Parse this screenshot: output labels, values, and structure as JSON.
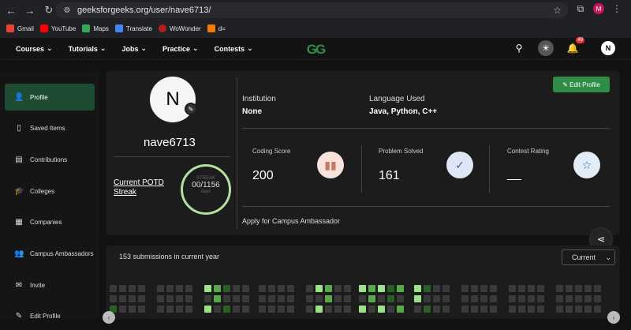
{
  "browser": {
    "url": "geeksforgeeks.org/user/nave6713/",
    "bookmarks": [
      "Gmail",
      "YouTube",
      "Maps",
      "Translate",
      "WoWonder",
      "d="
    ],
    "profile_initial": "M"
  },
  "nav": {
    "items": [
      "Courses",
      "Tutorials",
      "Jobs",
      "Practice",
      "Contests"
    ],
    "logo": "GG",
    "notifications": "49",
    "user_initial": "N"
  },
  "sidebar": {
    "items": [
      {
        "label": "Profile",
        "icon": "user-icon"
      },
      {
        "label": "Saved Items",
        "icon": "bookmark-icon"
      },
      {
        "label": "Contributions",
        "icon": "document-icon"
      },
      {
        "label": "Colleges",
        "icon": "graduation-cap-icon"
      },
      {
        "label": "Companies",
        "icon": "building-icon"
      },
      {
        "label": "Campus Ambassadors",
        "icon": "group-icon"
      },
      {
        "label": "Invite",
        "icon": "mail-icon"
      },
      {
        "label": "Edit Profile",
        "icon": "edit-icon"
      }
    ]
  },
  "profile": {
    "avatar_initial": "N",
    "username": "nave6713",
    "potd_label": "Current POTD Streak",
    "streak_label": "STREAK",
    "streak_current": "00",
    "streak_total": "/1156",
    "streak_unit": "days",
    "institution_label": "Institution",
    "institution_value": "None",
    "language_label": "Language Used",
    "language_value": "Java, Python, C++",
    "edit_profile": "Edit Profile",
    "coding_score_label": "Coding Score",
    "coding_score_value": "200",
    "problems_label": "Problem Solved",
    "problems_value": "161",
    "contest_label": "Contest Rating",
    "contest_value": "__",
    "campus": "Apply for Campus Ambassador"
  },
  "submissions": {
    "summary": "153 submissions in current year",
    "period": "Current"
  },
  "colors": {
    "brand_green": "#2f8d46",
    "heat_empty": "#3a3a3a",
    "heat_light": "#9be28a",
    "heat_mid": "#59a84a",
    "heat_dark": "#2a5e26"
  }
}
